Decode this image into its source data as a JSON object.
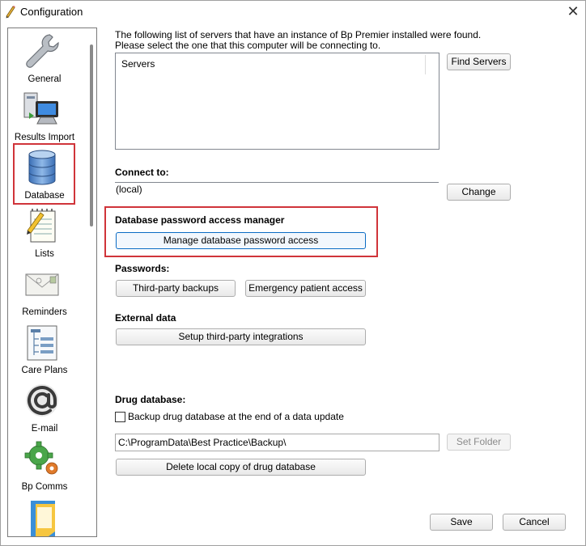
{
  "window": {
    "title": "Configuration",
    "close_glyph": "✕"
  },
  "sidebar": {
    "items": [
      {
        "label": "General",
        "icon": "wrench-icon"
      },
      {
        "label": "Results Import",
        "icon": "computer-import-icon"
      },
      {
        "label": "Database",
        "icon": "database-icon",
        "selected": true
      },
      {
        "label": "Lists",
        "icon": "notepad-list-icon"
      },
      {
        "label": "Reminders",
        "icon": "envelope-icon"
      },
      {
        "label": "Care Plans",
        "icon": "care-plan-document-icon"
      },
      {
        "label": "E-mail",
        "icon": "at-sign-icon"
      },
      {
        "label": "Bp Comms",
        "icon": "gears-icon"
      }
    ]
  },
  "servers": {
    "intro_line1": "The following list of servers that have an instance of Bp Premier installed were found.",
    "intro_line2": "Please select the one that this computer will be connecting to.",
    "column_header": "Servers",
    "find_button": "Find Servers"
  },
  "connect": {
    "heading": "Connect to:",
    "value": "(local)",
    "change_button": "Change"
  },
  "password_manager": {
    "heading": "Database password access manager",
    "button": "Manage database password access"
  },
  "passwords": {
    "heading": "Passwords:",
    "third_party_button": "Third-party backups",
    "emergency_button": "Emergency patient access"
  },
  "external": {
    "heading": "External data",
    "setup_button": "Setup third-party integrations"
  },
  "drug_db": {
    "heading": "Drug database:",
    "backup_checkbox_label": "Backup drug database at the end of a data update",
    "backup_checked": false,
    "path": "C:\\ProgramData\\Best Practice\\Backup\\",
    "set_folder_button": "Set Folder",
    "delete_button": "Delete local copy of drug database"
  },
  "footer": {
    "save_button": "Save",
    "cancel_button": "Cancel"
  },
  "colors": {
    "highlight": "#d0343a",
    "focus_border": "#0a6bc4"
  }
}
